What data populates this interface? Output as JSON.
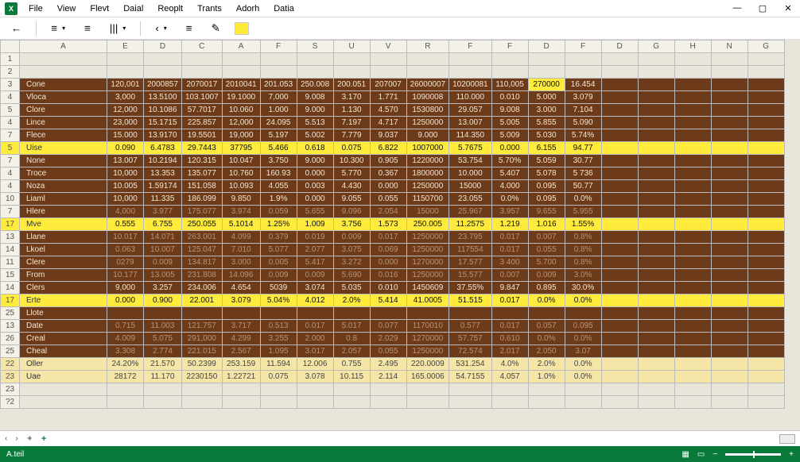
{
  "menu": [
    "File",
    "View",
    "Flevt",
    "Daial",
    "Reoplt",
    "Trants",
    "Adorh",
    "Datia"
  ],
  "win": {
    "min": "—",
    "max": "▢",
    "close": "✕"
  },
  "toolbar": {
    "back": "←",
    "a1": "≡",
    "a2": "≡",
    "a3": "|||",
    "g1": "‹",
    "g2": "≡",
    "g3": "✎"
  },
  "columns": [
    "A",
    "E",
    "D",
    "C",
    "A",
    "F",
    "S",
    "U",
    "V",
    "R",
    "F",
    "F",
    "D",
    "F"
  ],
  "ext_columns": [
    "D",
    "G",
    "H",
    "N",
    "G"
  ],
  "rows": [
    {
      "n": "1",
      "label": "",
      "cells": [],
      "style": "empty"
    },
    {
      "n": "2",
      "label": "",
      "cells": [],
      "style": "empty"
    },
    {
      "n": "3",
      "label": "Cone",
      "cells": [
        "120,001",
        "2000857",
        "2070017",
        "2010041",
        "201.053",
        "250.008",
        "200.051",
        "207007",
        "26000007",
        "10200081",
        "110,005",
        "270000",
        "16.454"
      ],
      "style": "brown",
      "hl": [
        11
      ]
    },
    {
      "n": "4",
      "label": "Vloca",
      "cells": [
        "3,000",
        "13.5100",
        "103.1007",
        "19.1000",
        "7,000",
        "9.008",
        "3.170",
        "1.771",
        "1090008",
        "110.000",
        "0.010",
        "5.000",
        "3.079"
      ],
      "style": "brown"
    },
    {
      "n": "5",
      "label": "Clore",
      "cells": [
        "12,000",
        "10.1086",
        "57.7017",
        "10.060",
        "1.000",
        "9.000",
        "1.130",
        "4.570",
        "1530800",
        "29.057",
        "9.008",
        "3.000",
        "7.104"
      ],
      "style": "brown"
    },
    {
      "n": "4",
      "label": "Lince",
      "cells": [
        "23,000",
        "15.1715",
        "225.857",
        "12,000",
        "24.095",
        "5.513",
        "7.197",
        "4.717",
        "1250000",
        "13.007",
        "5.005",
        "5.855",
        "5.090"
      ],
      "style": "brown"
    },
    {
      "n": "7",
      "label": "Flece",
      "cells": [
        "15.000",
        "13.9170",
        "19.5501",
        "19,000",
        "5.197",
        "5.002",
        "7.779",
        "9.037",
        "9.000",
        "114.350",
        "5.009",
        "5.030",
        "5.74%"
      ],
      "style": "brown"
    },
    {
      "n": "5",
      "label": "Uise",
      "cells": [
        "0.090",
        "6.4783",
        "29.7443",
        "37795",
        "5.466",
        "0.618",
        "0.075",
        "6.822",
        "1007000",
        "5.7675",
        "0.000",
        "6.155",
        "94.77"
      ],
      "style": "yellow"
    },
    {
      "n": "7",
      "label": "None",
      "cells": [
        "13.007",
        "10.2194",
        "120.315",
        "10.047",
        "3.750",
        "9.000",
        "10.300",
        "0.905",
        "1220000",
        "53.754",
        "5.70%",
        "5.059",
        "30.77"
      ],
      "style": "brown"
    },
    {
      "n": "4",
      "label": "Troce",
      "cells": [
        "10,000",
        "13.353",
        "135.077",
        "10.760",
        "160.93",
        "0.000",
        "5.770",
        "0.367",
        "1800000",
        "10.000",
        "5.407",
        "5.078",
        "5 736"
      ],
      "style": "brown"
    },
    {
      "n": "4",
      "label": "Noza",
      "cells": [
        "10.005",
        "1.59174",
        "151.058",
        "10.093",
        "4.055",
        "0.003",
        "4.430",
        "0.000",
        "1250000",
        "15000",
        "4.000",
        "0.095",
        "50.77"
      ],
      "style": "brown"
    },
    {
      "n": "10",
      "label": "Liaml",
      "cells": [
        "10,000",
        "11.335",
        "186.099",
        "9.850",
        "1.9%",
        "0.000",
        "9.055",
        "0.055",
        "1150700",
        "23.055",
        "0.0%",
        "0.095",
        "0.0%"
      ],
      "style": "brown"
    },
    {
      "n": "7",
      "label": "Hlere",
      "cells": [
        "4,000",
        "3.977",
        "175.077",
        "3.974",
        "0.059",
        "5.655",
        "9.096",
        "2.054",
        "15000",
        "25.967",
        "3.957",
        "9.655",
        "5.955"
      ],
      "style": "brown",
      "dim": true
    },
    {
      "n": "17",
      "label": "Mve",
      "cells": [
        "0.555",
        "6.755",
        "250.055",
        "5.1014",
        "1.25%",
        "1.009",
        "3.756",
        "1.573",
        "250.005",
        "11.2575",
        "1.219",
        "1.016",
        "1.55%"
      ],
      "style": "yellow"
    },
    {
      "n": "13",
      "label": "Llane",
      "cells": [
        "10.017",
        "14.071",
        "263.001",
        "4.099",
        "0.379",
        "0.019",
        "0.009",
        "0.017",
        "1250000",
        "23.795",
        "0.017",
        "0.007",
        "0.8%"
      ],
      "style": "brown",
      "dim": true
    },
    {
      "n": "14",
      "label": "Lkoel",
      "cells": [
        "0.063",
        "10.007",
        "125.047",
        "7.010",
        "5.077",
        "2.077",
        "3.075",
        "0.069",
        "1250000",
        "117554",
        "0.017",
        "0.055",
        "0.8%"
      ],
      "style": "brown",
      "dim": true
    },
    {
      "n": "11",
      "label": "Clere",
      "cells": [
        "0279",
        "0.009",
        "134.817",
        "3.000",
        "0.005",
        "5.417",
        "3.272",
        "0.000",
        "1270000",
        "17.577",
        "3 400",
        "5.700",
        "0.8%"
      ],
      "style": "brown",
      "dim": true
    },
    {
      "n": "15",
      "label": "From",
      "cells": [
        "10.177",
        "13.005",
        "231.808",
        "14.096",
        "0.009",
        "0.009",
        "5.690",
        "0.016",
        "1250000",
        "15.577",
        "0.007",
        "0.009",
        "3.0%"
      ],
      "style": "brown",
      "dim": true
    },
    {
      "n": "14",
      "label": "Clers",
      "cells": [
        "9,000",
        "3.257",
        "234.006",
        "4.654",
        "5039",
        "3.074",
        "5.035",
        "0.010",
        "1450609",
        "37.55%",
        "9.847",
        "0.895",
        "30.0%"
      ],
      "style": "brown"
    },
    {
      "n": "17",
      "label": "Erte",
      "cells": [
        "0.000",
        "0.900",
        "22.001",
        "3.079",
        "5.04%",
        "4.012",
        "2.0%",
        "5.414",
        "41.0005",
        "51.515",
        "0.017",
        "0.0%",
        "0.0%"
      ],
      "style": "yellow"
    },
    {
      "n": "25",
      "label": "Llote",
      "cells": [],
      "style": "brown"
    },
    {
      "n": "13",
      "label": "Date",
      "cells": [
        "0.715",
        "11.003",
        "121.757",
        "3.717",
        "0.513",
        "0.017",
        "5.017",
        "0.077",
        "1170010",
        "0.577",
        "0.017",
        "0.057",
        "0.095"
      ],
      "style": "brown",
      "dim": true
    },
    {
      "n": "26",
      "label": "Creal",
      "cells": [
        "4.009",
        "5.075",
        "291,000",
        "4.299",
        "3.255",
        "2.000",
        "0.8",
        "2.029",
        "1270000",
        "57.757",
        "0.610",
        "0.0%",
        "0.0%"
      ],
      "style": "brown",
      "dim": true
    },
    {
      "n": "25",
      "label": "Cheal",
      "cells": [
        "3.308",
        "2.774",
        "221.015",
        "2.567",
        "1.095",
        "3.017",
        "2.057",
        "0.055",
        "1250000",
        "72.574",
        "2.017",
        "2.050",
        "3.07"
      ],
      "style": "brown",
      "dim": true
    },
    {
      "n": "22",
      "label": "Oller",
      "cells": [
        "24.20%",
        "21.570",
        "50.2399",
        "253.159",
        "11.594",
        "12.006",
        "0.755",
        "2.495",
        "220.0009",
        "531.254",
        "4.0%",
        "2.0%",
        "0.0%"
      ],
      "style": "cream"
    },
    {
      "n": "23",
      "label": "Uae",
      "cells": [
        "28172",
        "11.170",
        "2230150",
        "1.22721",
        "0.075",
        "3.078",
        "10.115",
        "2.114",
        "165.0006",
        "54.7155",
        "4.057",
        "1.0%",
        "0.0%"
      ],
      "style": "cream"
    },
    {
      "n": "23",
      "label": "",
      "cells": [],
      "style": "empty"
    },
    {
      "n": "?2",
      "label": "",
      "cells": [],
      "style": "empty"
    }
  ],
  "status": {
    "left": "A.teil",
    "plus": "+"
  }
}
